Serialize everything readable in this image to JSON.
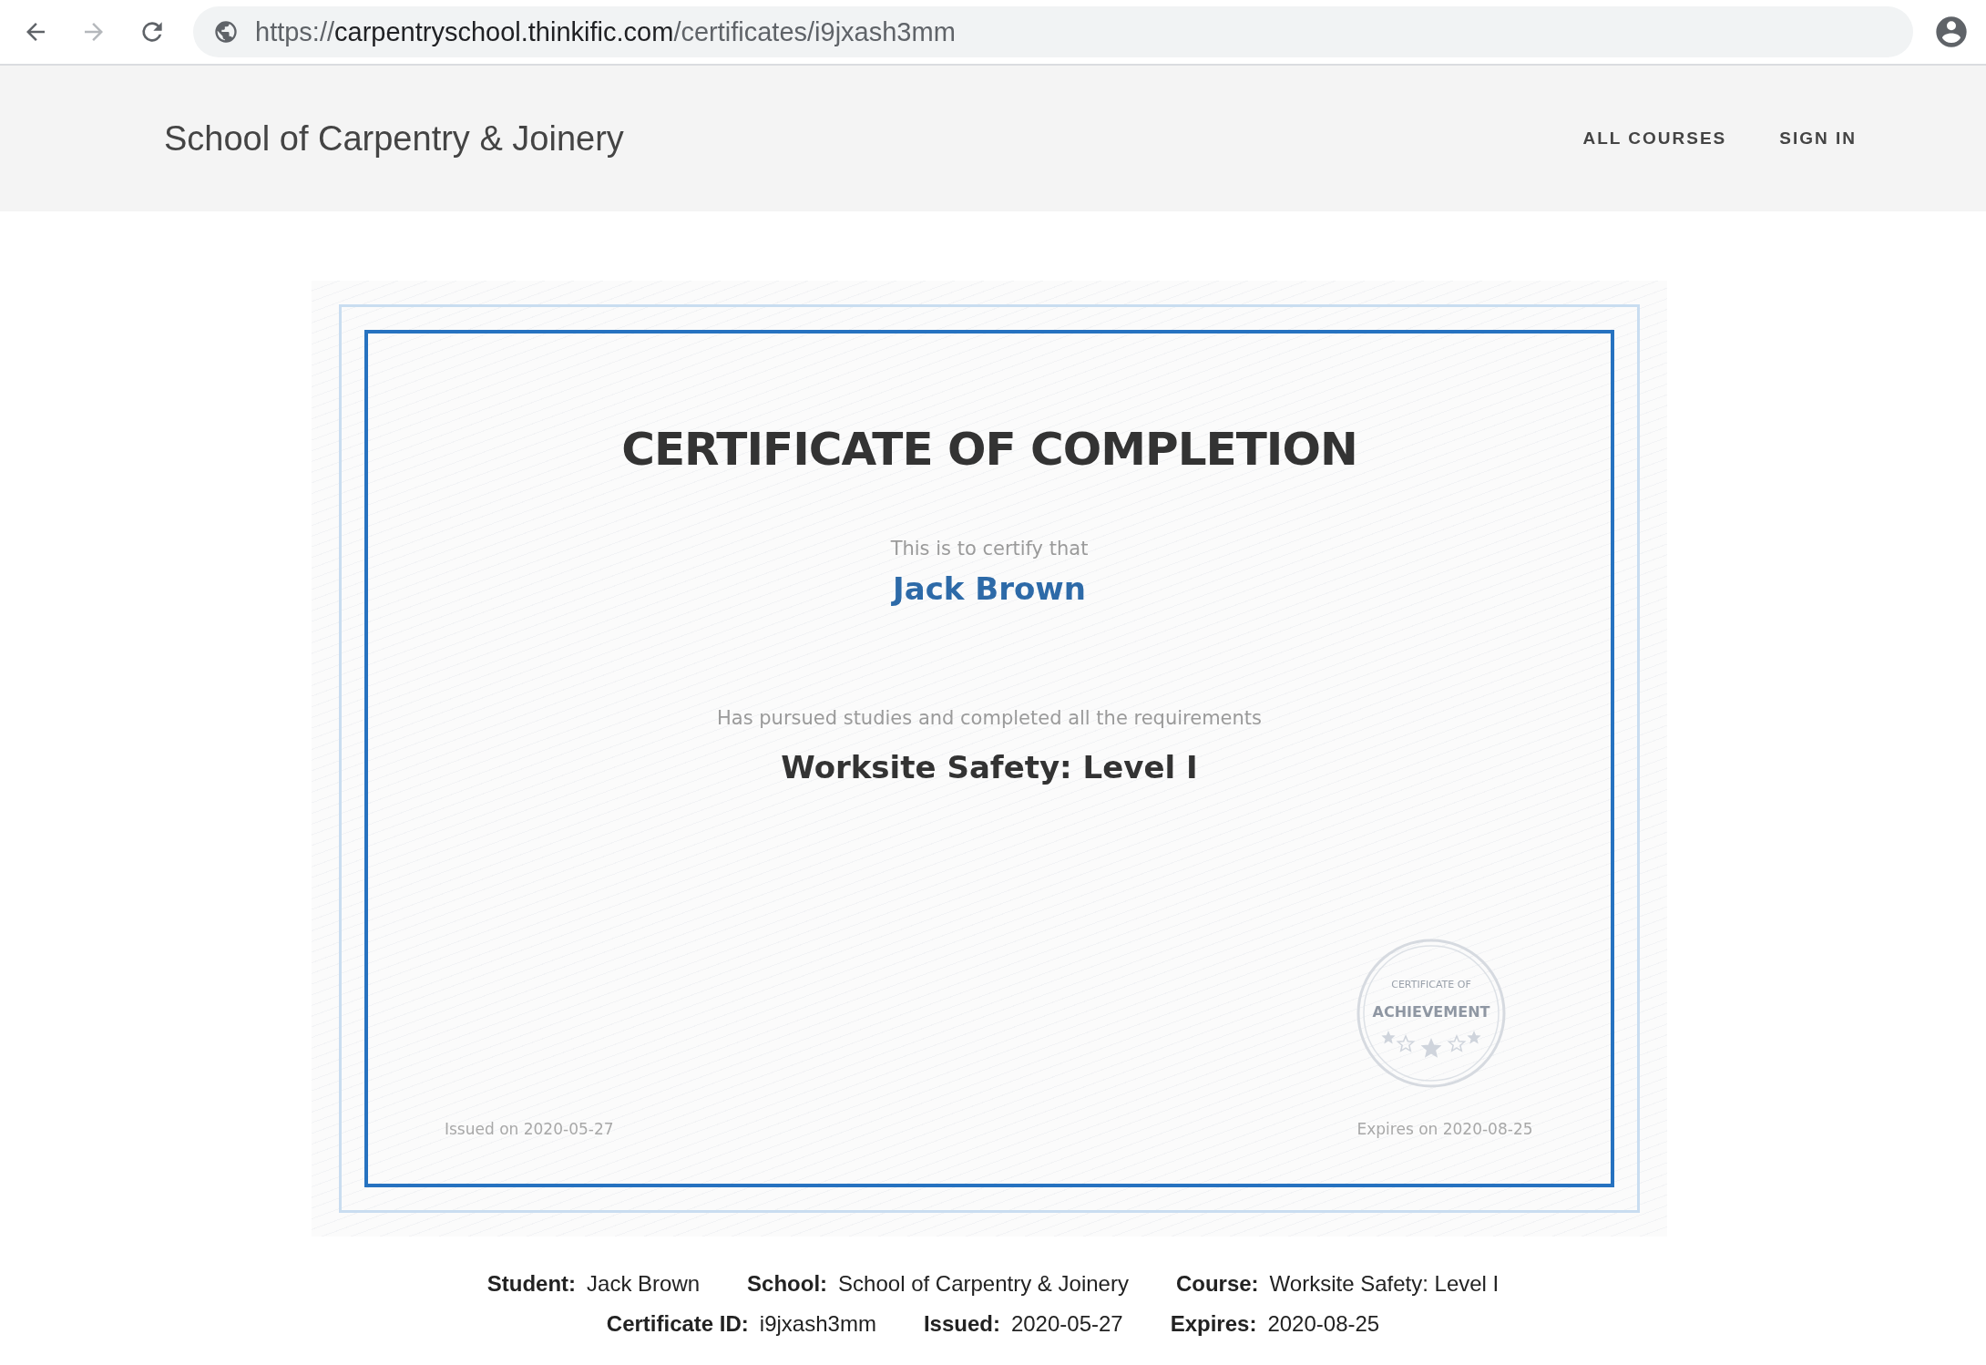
{
  "browser": {
    "url": {
      "scheme": "https://",
      "host": "carpentryschool.thinkific.com",
      "path": "/certificates/i9jxash3mm"
    },
    "forward_disabled": true
  },
  "header": {
    "school": "School of Carpentry & Joinery",
    "nav": [
      "ALL COURSES",
      "SIGN IN"
    ]
  },
  "certificate": {
    "title": "CERTIFICATE OF COMPLETION",
    "intro": "This is to certify that",
    "student": "Jack Brown",
    "statement": "Has pursued studies and completed all the requirements",
    "course": "Worksite Safety: Level I",
    "seal": {
      "top": "CERTIFICATE OF",
      "main": "ACHIEVEMENT"
    },
    "issued": "Issued on 2020-05-27",
    "expires": "Expires on 2020-08-25"
  },
  "details": [
    [
      {
        "label": "Student:",
        "value": "Jack Brown"
      },
      {
        "label": "School:",
        "value": "School of Carpentry & Joinery"
      },
      {
        "label": "Course:",
        "value": "Worksite Safety: Level I"
      }
    ],
    [
      {
        "label": "Certificate ID:",
        "value": "i9jxash3mm"
      },
      {
        "label": "Issued:",
        "value": "2020-05-27"
      },
      {
        "label": "Expires:",
        "value": "2020-08-25"
      }
    ]
  ]
}
